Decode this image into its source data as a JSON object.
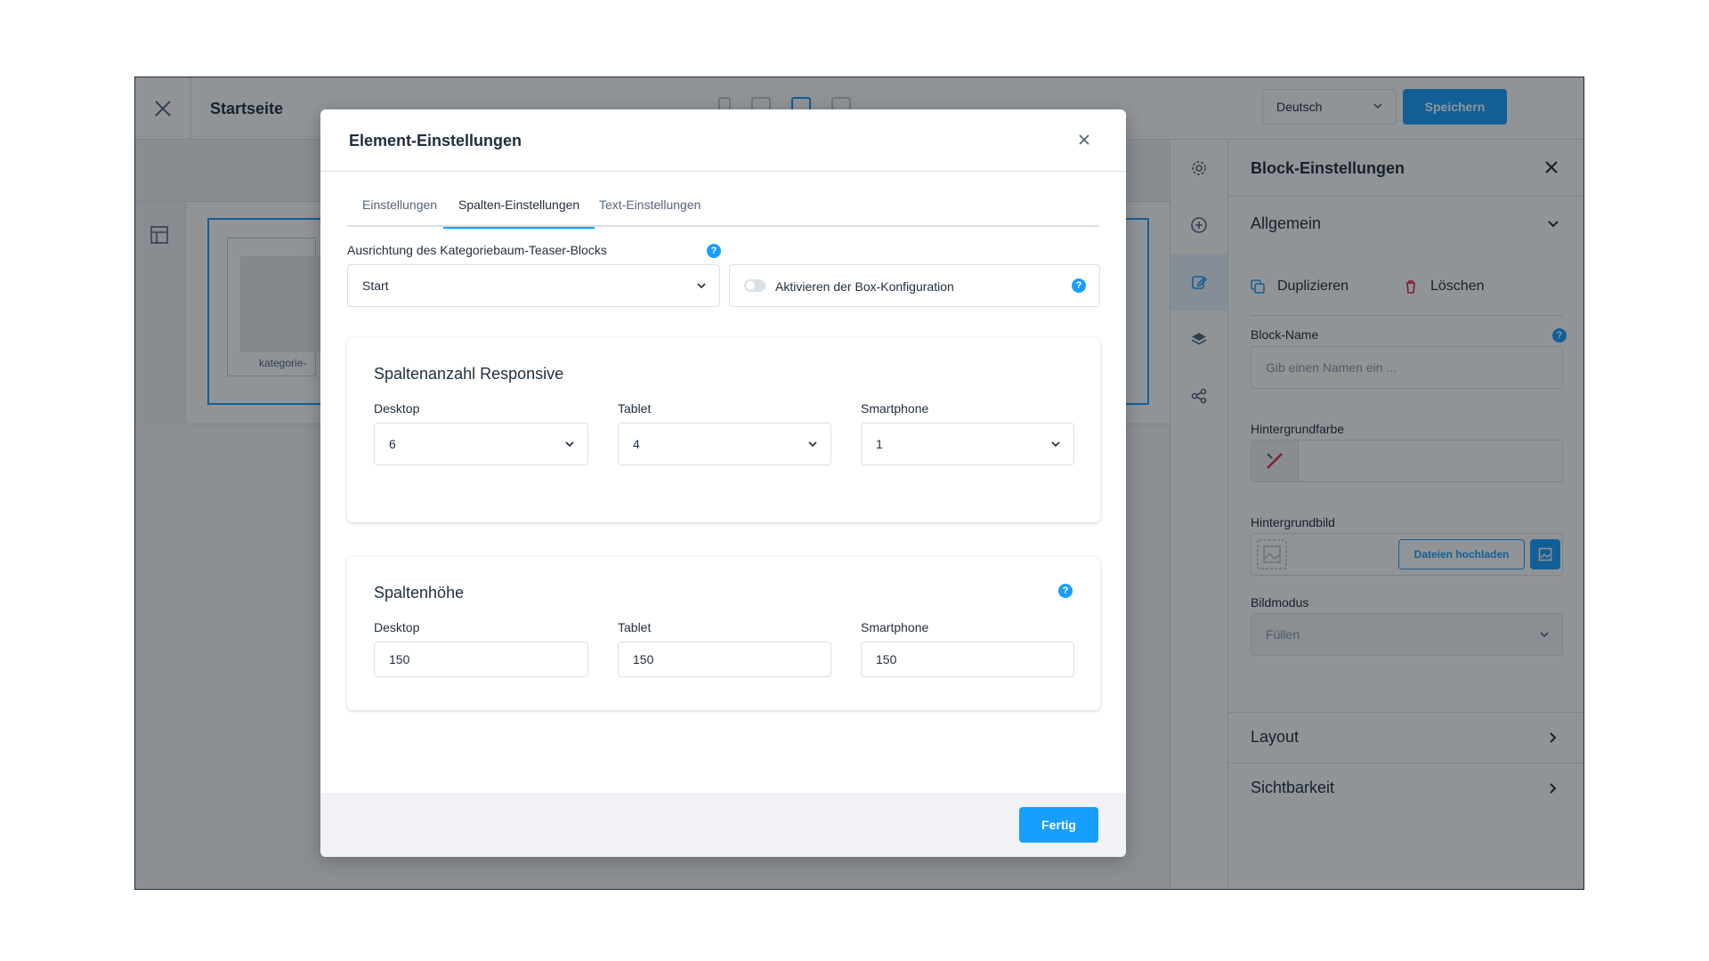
{
  "editor": {
    "page_title": "Startseite",
    "language": "Deutsch",
    "save_label": "Speichern",
    "canvas_block_label": "kategorie-"
  },
  "block_panel": {
    "title": "Block-Einstellungen",
    "general_label": "Allgemein",
    "duplicate_label": "Duplizieren",
    "delete_label": "Löschen",
    "name_label": "Block-Name",
    "name_placeholder": "Gib einen Namen ein ...",
    "bgcolor_label": "Hintergrundfarbe",
    "bgimage_label": "Hintergrundbild",
    "upload_label": "Dateien hochladen",
    "mode_label": "Bildmodus",
    "mode_value": "Füllen",
    "layout_label": "Layout",
    "visibility_label": "Sichtbarkeit"
  },
  "modal": {
    "title": "Element-Einstellungen",
    "tabs": [
      {
        "label": "Einstellungen"
      },
      {
        "label": "Spalten-Einstellungen"
      },
      {
        "label": "Text-Einstellungen"
      }
    ],
    "alignment_label": "Ausrichtung des Kategoriebaum-Teaser-Blocks",
    "alignment_value": "Start",
    "box_config_label": "Aktivieren der Box-Konfiguration",
    "columns_card": {
      "title": "Spaltenanzahl Responsive",
      "desktop_label": "Desktop",
      "desktop_value": "6",
      "tablet_label": "Tablet",
      "tablet_value": "4",
      "smartphone_label": "Smartphone",
      "smartphone_value": "1"
    },
    "height_card": {
      "title": "Spaltenhöhe",
      "desktop_label": "Desktop",
      "desktop_value": "150",
      "tablet_label": "Tablet",
      "tablet_value": "150",
      "smartphone_label": "Smartphone",
      "smartphone_value": "150"
    },
    "done_label": "Fertig",
    "help_glyph": "?"
  },
  "colors": {
    "accent": "#189eff",
    "text": "#1f2e3d",
    "border": "#d9e0e8",
    "delete": "#de294c"
  },
  "icons": [
    "close-icon",
    "chevron-down-icon",
    "chevron-right-icon",
    "gear-icon",
    "plus-circle-icon",
    "edit-icon",
    "layers-icon",
    "share-icon",
    "layout-icon",
    "duplicate-icon",
    "trash-icon",
    "help-icon",
    "no-color-icon",
    "image-icon",
    "media-icon"
  ]
}
